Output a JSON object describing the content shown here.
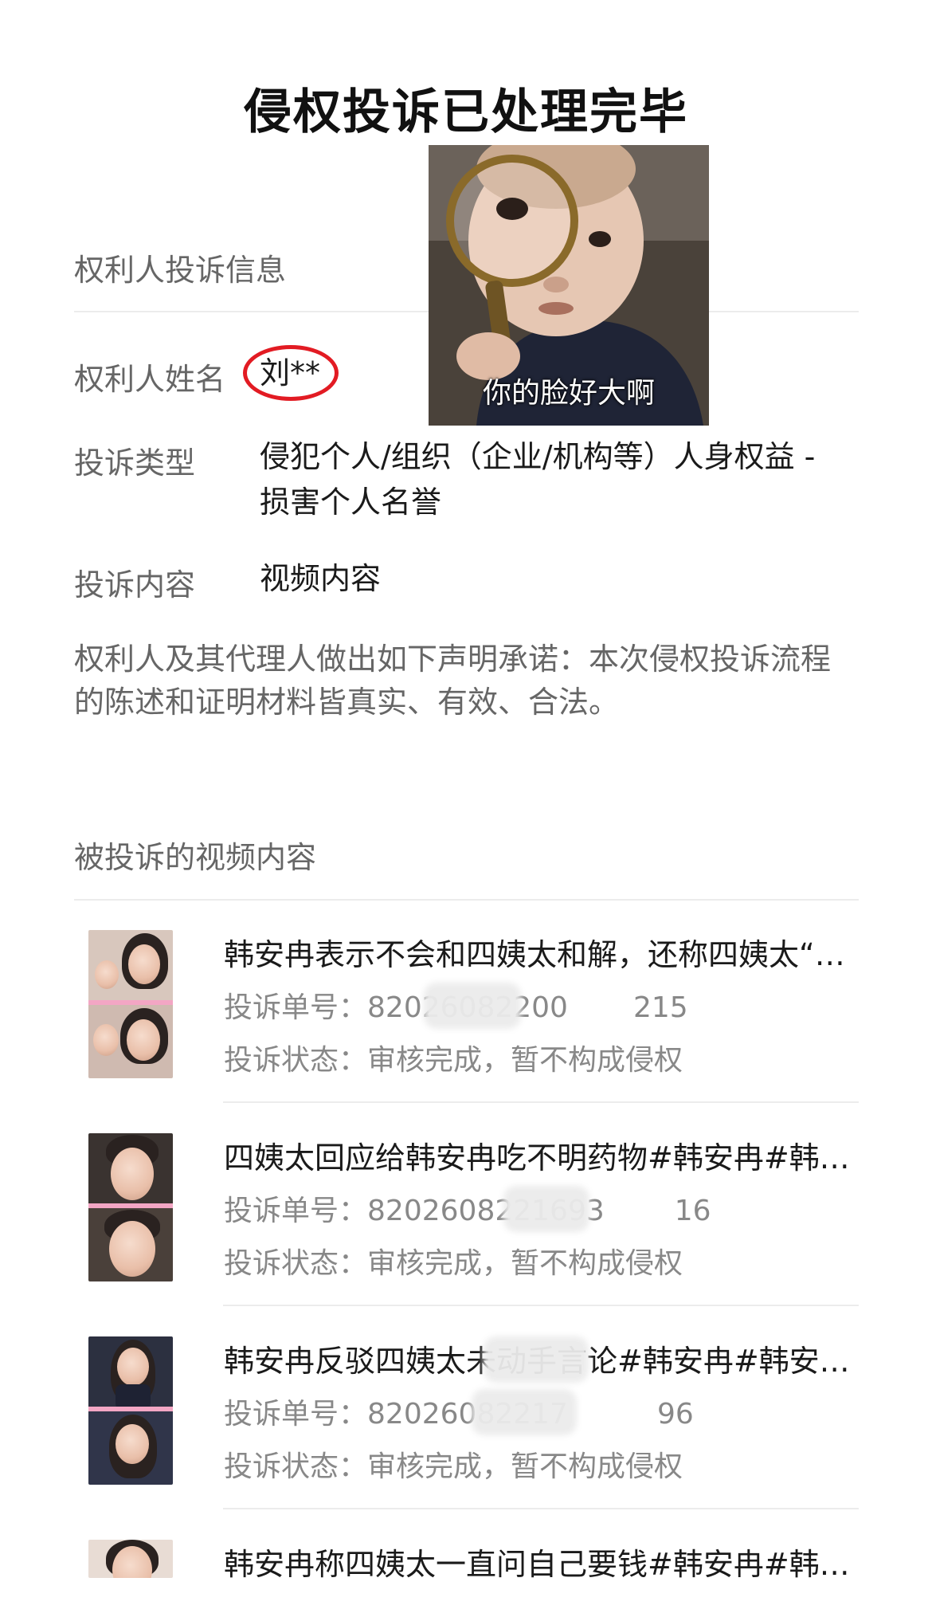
{
  "title": "侵权投诉已处理完毕",
  "complainant_section": {
    "heading": "权利人投诉信息",
    "name_label": "权利人姓名",
    "name_value": "刘**",
    "type_label": "投诉类型",
    "type_value_line1": "侵犯个人/组织（企业/机构等）人身权益 -",
    "type_value_line2": "损害个人名誉",
    "content_label": "投诉内容",
    "content_value": "视频内容",
    "statement_line1": "权利人及其代理人做出如下声明承诺：本次侵权投诉流程",
    "statement_line2": "的陈述和证明材料皆真实、有效、合法。"
  },
  "meme": {
    "caption": "你的脸好大啊"
  },
  "videos_section": {
    "heading": "被投诉的视频内容",
    "items": [
      {
        "title": "韩安冉表示不会和四姨太和解，还称四姨太“…",
        "order_label": "投诉单号：",
        "order_number": "82026082200",
        "order_suffix": "215",
        "status_label": "投诉状态：",
        "status_value": "审核完成，暂不构成侵权"
      },
      {
        "title": "四姨太回应给韩安冉吃不明药物#韩安冉#韩…",
        "order_label": "投诉单号：",
        "order_number": "8202608221693",
        "order_suffix": "16",
        "status_label": "投诉状态：",
        "status_value": "审核完成，暂不构成侵权"
      },
      {
        "title": "韩安冉反驳四姨太未动手言论#韩安冉#韩安…",
        "order_label": "投诉单号：",
        "order_number": "82026082217",
        "order_suffix": "96",
        "status_label": "投诉状态：",
        "status_value": "审核完成，暂不构成侵权"
      },
      {
        "title": "韩安冉称四姨太一直问自己要钱#韩安冉#韩…"
      }
    ]
  }
}
